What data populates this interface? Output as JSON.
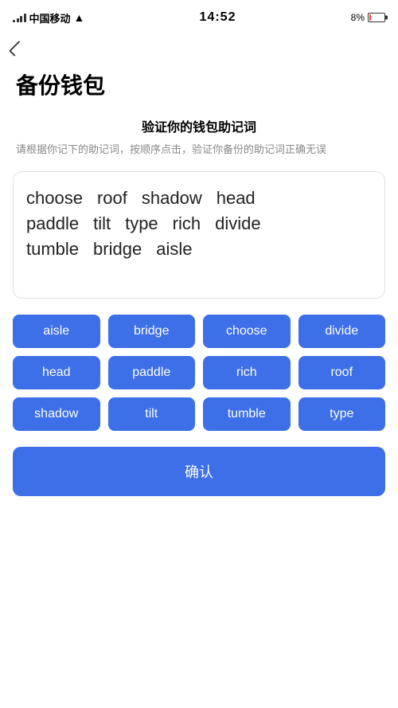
{
  "statusBar": {
    "carrier": "中国移动",
    "time": "14:52",
    "battery": "8%"
  },
  "back": {
    "label": "‹"
  },
  "pageTitle": "备份钱包",
  "section": {
    "heading": "验证你的钱包助记词",
    "desc": "请根据你记下的助记词，按顺序点击，验证你备份的助记词正确无误"
  },
  "displayWords": [
    [
      "choose",
      "roof",
      "shadow",
      "head"
    ],
    [
      "paddle",
      "tilt",
      "type",
      "rich",
      "divide"
    ],
    [
      "tumble",
      "bridge",
      "aisle"
    ]
  ],
  "chips": [
    "aisle",
    "bridge",
    "choose",
    "divide",
    "head",
    "paddle",
    "rich",
    "roof",
    "shadow",
    "tilt",
    "tumble",
    "type"
  ],
  "confirmButton": {
    "label": "确认"
  }
}
